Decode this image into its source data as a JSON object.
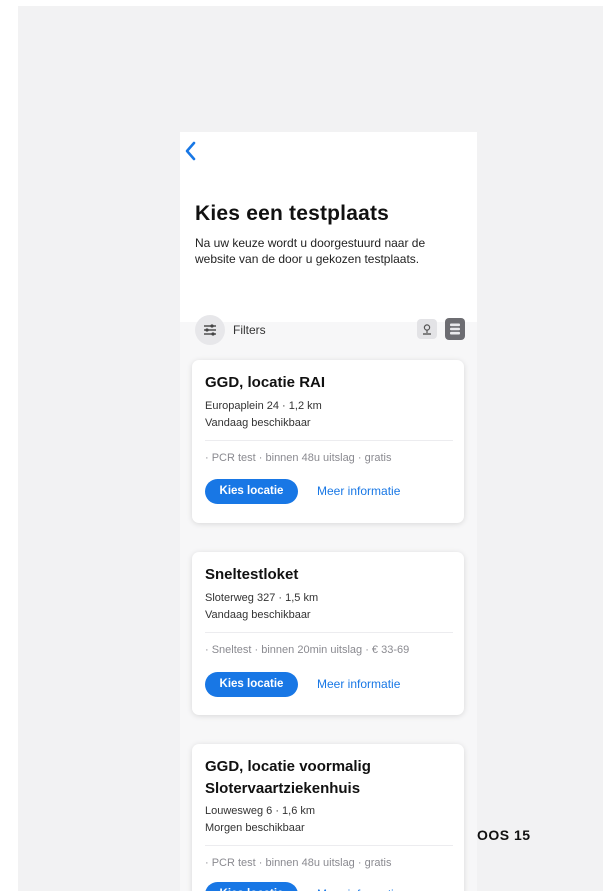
{
  "header": {
    "back_icon": "chevron-left-icon",
    "title": "Kies een testplaats",
    "subtitle": "Na uw keuze wordt u doorgestuurd naar de website van de door u gekozen testplaats."
  },
  "filters": {
    "label": "Filters",
    "filter_icon": "sliders-icon",
    "map_icon": "map-pin-icon",
    "list_icon": "list-icon"
  },
  "locations": [
    {
      "name": "GGD, locatie RAI",
      "address": "Europaplein 24 · 1,2 km",
      "availability": "Vandaag beschikbaar",
      "tags": "· PCR test · binnen 48u uitslag · gratis",
      "choose_label": "Kies locatie",
      "info_label": "Meer informatie"
    },
    {
      "name": "Sneltestloket",
      "address": "Sloterweg 327 · 1,5 km",
      "availability": "Vandaag beschikbaar",
      "tags": "· Sneltest · binnen 20min uitslag · € 33-69",
      "choose_label": "Kies locatie",
      "info_label": "Meer informatie"
    },
    {
      "name": "GGD, locatie voormalig Slotervaartziekenhuis",
      "address": "Louwesweg 6 · 1,6 km",
      "availability": "Morgen beschikbaar",
      "tags": "· PCR test · binnen 48u uitslag · gratis",
      "choose_label": "Kies locatie",
      "info_label": "Meer informatie"
    }
  ],
  "side_label": "OOS 15",
  "colors": {
    "accent": "#1877e5",
    "background": "#f2f2f3",
    "card": "#ffffff"
  }
}
